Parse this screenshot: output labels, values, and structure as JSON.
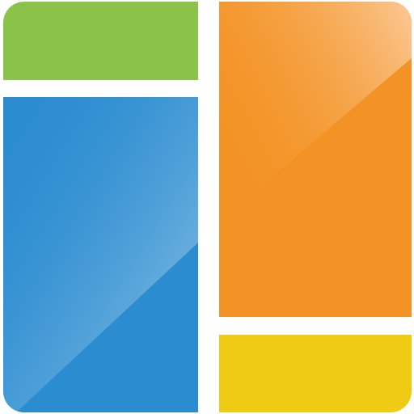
{
  "colors": {
    "green": "#8BC34A",
    "blue": "#2B8CD0",
    "blue_light": "#9FCDEB",
    "orange": "#F39325",
    "orange_light": "#FBC995",
    "yellow": "#F0CB14"
  },
  "tiles": [
    {
      "id": "green",
      "color": "#8BC34A"
    },
    {
      "id": "blue",
      "color": "#2B8CD0",
      "gloss": "#9FCDEB"
    },
    {
      "id": "orange",
      "color": "#F39325",
      "gloss": "#FBC995"
    },
    {
      "id": "yellow",
      "color": "#F0CB14"
    }
  ]
}
